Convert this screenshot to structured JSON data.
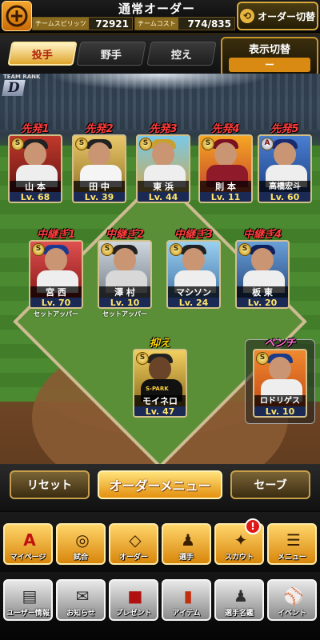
{
  "header": {
    "title": "通常オーダー",
    "team_spirits_label": "チームスピリッツ",
    "team_spirits_value": "72921",
    "team_cost_label": "チームコスト",
    "team_cost_value": "774/835",
    "switch_order_label": "オーダー切替"
  },
  "tabs": [
    {
      "label": "投手",
      "active": true
    },
    {
      "label": "野手",
      "active": false
    },
    {
      "label": "控え",
      "active": false
    }
  ],
  "display_toggle": {
    "label": "表示切替",
    "value": "ー"
  },
  "team_rank": {
    "label": "TEAM RANK",
    "value": "D"
  },
  "slots": {
    "starters": [
      {
        "label": "先発1",
        "badge": "S",
        "name": "山 本",
        "level": "Lv. 68"
      },
      {
        "label": "先発2",
        "badge": "S",
        "name": "田 中",
        "level": "Lv. 39"
      },
      {
        "label": "先発3",
        "badge": "S",
        "name": "東 浜",
        "level": "Lv. 44"
      },
      {
        "label": "先発4",
        "badge": "S",
        "name": "則 本",
        "level": "Lv. 11"
      },
      {
        "label": "先発5",
        "badge": "A",
        "name": "高橋宏斗",
        "level": "Lv. 60"
      }
    ],
    "relievers": [
      {
        "label": "中継ぎ1",
        "badge": "S",
        "name": "宮 西",
        "level": "Lv. 70",
        "role": "セットアッパー"
      },
      {
        "label": "中継ぎ2",
        "badge": "S",
        "name": "澤 村",
        "level": "Lv. 10",
        "role": "セットアッパー"
      },
      {
        "label": "中継ぎ3",
        "badge": "S",
        "name": "マシソン",
        "level": "Lv. 24",
        "role": ""
      },
      {
        "label": "中継ぎ4",
        "badge": "S",
        "name": "板 東",
        "level": "Lv. 20",
        "role": ""
      }
    ],
    "closer": {
      "label": "抑え",
      "badge": "S",
      "name": "モイネロ",
      "level": "Lv. 47",
      "jersey": "S-PARK"
    },
    "bench": {
      "label": "ベンチ",
      "badge": "S",
      "name": "ロドリゲス",
      "level": "Lv. 10"
    }
  },
  "buttons": {
    "reset": "リセット",
    "order_menu": "オーダーメニュー",
    "save": "セーブ"
  },
  "nav_row1": [
    {
      "label": "マイページ",
      "icon": "a-emblem-icon"
    },
    {
      "label": "試合",
      "icon": "stadium-icon"
    },
    {
      "label": "オーダー",
      "icon": "field-icon"
    },
    {
      "label": "選手",
      "icon": "player-icon"
    },
    {
      "label": "スカウト",
      "icon": "scout-icon"
    },
    {
      "label": "メニュー",
      "icon": "menu-icon"
    }
  ],
  "nav_row2": [
    {
      "label": "ユーザー情報",
      "icon": "user-info-icon"
    },
    {
      "label": "お知らせ",
      "icon": "notice-icon"
    },
    {
      "label": "プレゼント",
      "icon": "gift-icon"
    },
    {
      "label": "アイテム",
      "icon": "item-icon"
    },
    {
      "label": "選手名鑑",
      "icon": "player-book-icon"
    },
    {
      "label": "イベント",
      "icon": "event-icon"
    }
  ],
  "notification_badge": "!",
  "colors": {
    "accent_gold": "#e4900f",
    "slot_label_red": "#ff3b3b",
    "level_yellow": "#ffe56a"
  }
}
